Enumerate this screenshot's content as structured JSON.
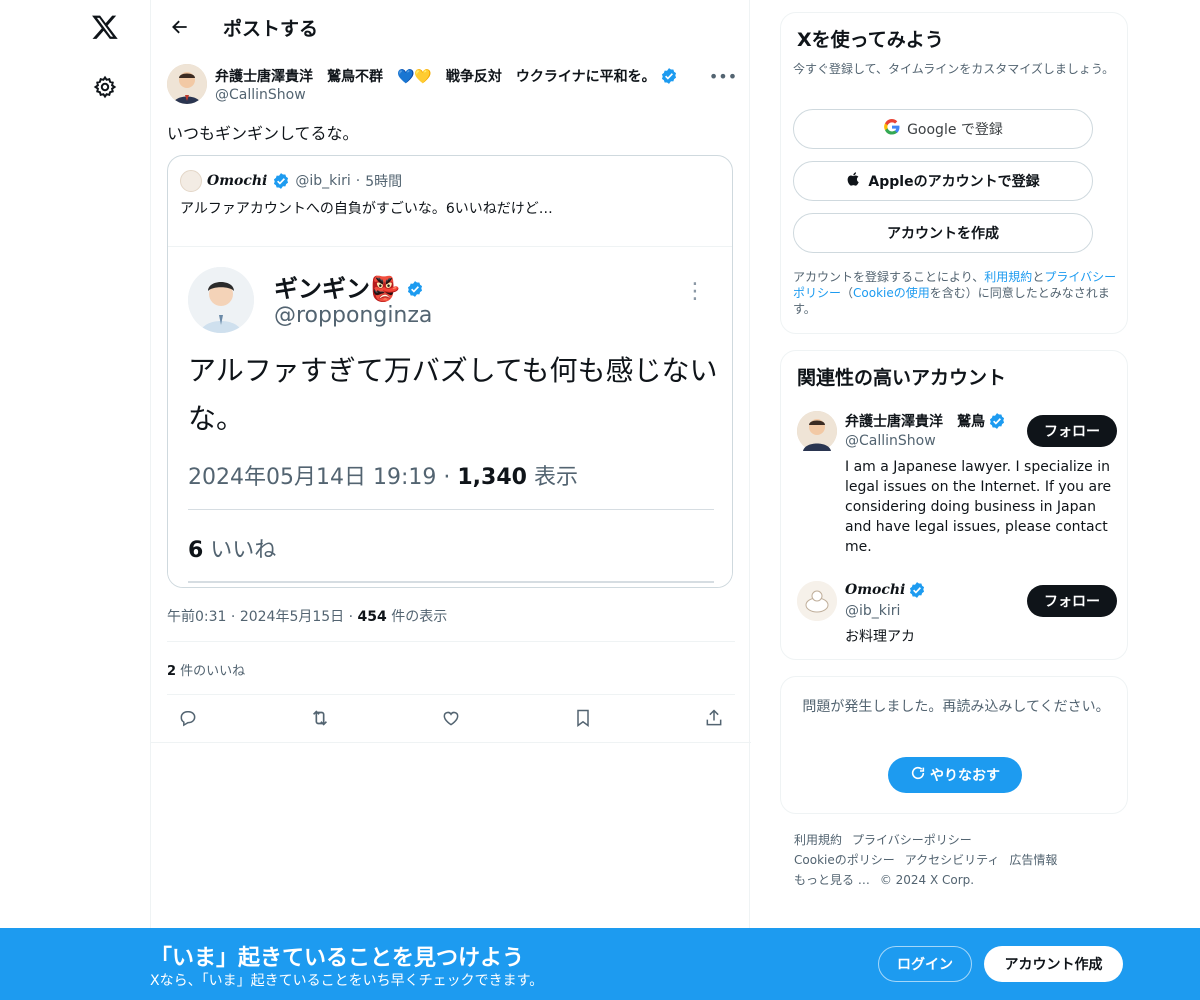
{
  "nav": {
    "logo_icon": "x-logo-icon",
    "settings_icon": "gear-icon"
  },
  "header": {
    "title": "ポストする",
    "back_icon": "arrow-left-icon"
  },
  "post": {
    "author_name": "弁護士唐澤貴洋　鷲鳥不群　💙💛　戦争反対　ウクライナに平和を。",
    "author_handle": "@CallinShow",
    "text": "いつもギンギンしてるな。",
    "quote": {
      "name": "Omochi",
      "handle": "@ib_kiri",
      "dot": "·",
      "time": "5時間",
      "text": "アルファアカウントへの自負がすごいな。6いいねだけど…",
      "image": {
        "name": "ギンギン👺",
        "handle": "@ropponginza",
        "text": "アルファすぎて万バズしても何も感じないな。",
        "date": "2024年05月14日 19:19 · ",
        "views_count": "1,340",
        "views_label": " 表示",
        "likes_count": "6",
        "likes_label": " いいね"
      }
    },
    "time": "午前0:31",
    "date": "2024年5月15日",
    "views_count": "454",
    "views_label": " 件の表示",
    "meta_sep": "·",
    "likes_count": "2",
    "likes_label": " 件のいいね"
  },
  "signup": {
    "title": "Xを使ってみよう",
    "subtitle": "今すぐ登録して、タイムラインをカスタマイズしましょう。",
    "google_label": "Google で登録",
    "apple_label": "Appleのアカウントで登録",
    "create_label": "アカウントを作成",
    "terms_pre": "アカウントを登録することにより、",
    "terms_link1": "利用規約",
    "terms_and": "と",
    "terms_link2": "プライバシーポリシー",
    "terms_mid": "（",
    "terms_link3": "Cookieの使用",
    "terms_post": "を含む）に同意したとみなされます。"
  },
  "related": {
    "title": "関連性の高いアカウント",
    "accounts": [
      {
        "name": "弁護士唐澤貴洋　鷲鳥",
        "handle": "@CallinShow",
        "bio": "I am a Japanese lawyer. I specialize in legal issues on the Internet. If you are considering doing business in Japan and have legal issues, please contact me.",
        "follow": "フォロー"
      },
      {
        "name": "Omochi",
        "handle": "@ib_kiri",
        "bio": "お料理アカ",
        "follow": "フォロー"
      }
    ]
  },
  "error_card": {
    "text": "問題が発生しました。再読み込みしてください。",
    "retry": "やりなおす"
  },
  "footer": {
    "links": [
      "利用規約",
      "プライバシーポリシー",
      "Cookieのポリシー",
      "アクセシビリティ",
      "広告情報",
      "もっと見る …",
      "© 2024 X Corp."
    ]
  },
  "bottombar": {
    "title": "「いま」起きていることを見つけよう",
    "subtitle": "Xなら、「いま」起きていることをいち早くチェックできます。",
    "login": "ログイン",
    "signup": "アカウント作成"
  },
  "colors": {
    "accent": "#1d9bf0",
    "text": "#0f1419",
    "muted": "#536471"
  }
}
